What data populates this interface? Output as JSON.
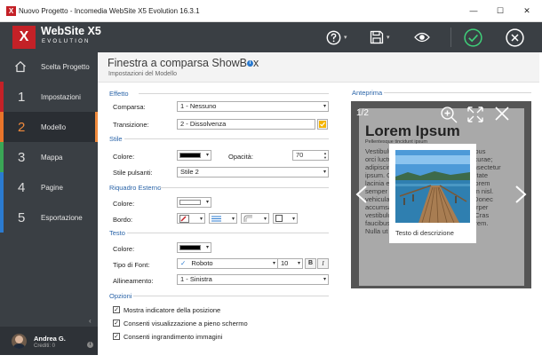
{
  "window": {
    "title": "Nuovo Progetto - Incomedia WebSite X5 Evolution 16.3.1",
    "app_icon_letter": "X",
    "controls": {
      "minimize": "—",
      "maximize": "☐",
      "close": "✕"
    }
  },
  "brand": {
    "logo_mark": "X",
    "name": "WebSite X5",
    "edition": "EVOLUTION"
  },
  "toolbar": {
    "icons": [
      "help-icon",
      "save-icon",
      "preview-eye-icon",
      "confirm-check-icon",
      "close-circle-icon"
    ],
    "chevron": "▾"
  },
  "sidebar": {
    "items": [
      {
        "num": "",
        "label": "Scelta Progetto",
        "icon": "home-icon",
        "color": ""
      },
      {
        "num": "1",
        "label": "Impostazioni",
        "color": "#c42127"
      },
      {
        "num": "2",
        "label": "Modello",
        "color": "#e8742a"
      },
      {
        "num": "3",
        "label": "Mappa",
        "color": "#3aa655"
      },
      {
        "num": "4",
        "label": "Pagine",
        "color": "#2b7bd0"
      },
      {
        "num": "5",
        "label": "Esportazione",
        "color": "#2b7bd0"
      }
    ],
    "active_index": 2,
    "collapse_glyph": "‹",
    "user": {
      "name": "Andrea G.",
      "credits": "Crediti: 0",
      "info": "i"
    }
  },
  "header": {
    "title": "Finestra a comparsa ShowBox",
    "subtitle": "Impostazioni del Modello",
    "info": "i"
  },
  "form": {
    "effetto": {
      "section": "Effetto",
      "comparsa_label": "Comparsa:",
      "comparsa_value": "1 - Nessuno",
      "transizione_label": "Transizione:",
      "transizione_value": "2 - Dissolvenza"
    },
    "stile": {
      "section": "Stile",
      "colore_label": "Colore:",
      "colore_value": "#000000",
      "opacita_label": "Opacità:",
      "opacita_value": "70",
      "pulsanti_label": "Stile pulsanti:",
      "pulsanti_value": "Stile 2"
    },
    "riquadro": {
      "section": "Riquadro Esterno",
      "colore_label": "Colore:",
      "colore_value": "#ffffff",
      "bordo_label": "Bordo:"
    },
    "testo": {
      "section": "Testo",
      "colore_label": "Colore:",
      "colore_value": "#000000",
      "font_label": "Tipo di Font:",
      "font_value": "Roboto",
      "font_check": "✓",
      "size_value": "10",
      "bold": "B",
      "italic": "I",
      "align_label": "Allineamento:",
      "align_value": "1 - Sinistra"
    },
    "opzioni": {
      "section": "Opzioni",
      "checks": [
        {
          "label": "Mostra indicatore della posizione",
          "checked": "✓"
        },
        {
          "label": "Consenti visualizzazione a pieno schermo",
          "checked": "✓"
        },
        {
          "label": "Consenti ingrandimento immagini",
          "checked": "✓"
        }
      ]
    },
    "dropdown_arrow": "▾",
    "spin_up": "▲",
    "spin_down": "▼"
  },
  "preview": {
    "label": "Anteprima",
    "counter": "1/2",
    "lorem_title": "Lorem Ipsum",
    "lorem_sub": "Pellentesque tincidunt ipsum",
    "lorem_lines": [
      "Vestibulum  ante  ipsum  primis  in  faucibus",
      "orci luctus et ultrices posuere cubilia curae;",
      "adipiscing elit. Sed mattis semper consectetur",
      "ipsum.  Quisque  vel  justo  et  velit  vulputate",
      "lacinia  eget  sed  sapien.  Nam  lacinia  lorem",
      "semper nulla vulputate sed elementum nisl.",
      "vehicula  consequat.  Aliquam  ut  arcu  Donec",
      "accumsan  erat  sit  amet  ligula  ullamcorper",
      "vestibulum  quam.  Mauris  id  mi  risus.  Cras",
      "faucibus justo quis, sollicitudin erat lorem.",
      "Nulla ut eleifend odio, ac mattis tortor."
    ],
    "caption": "Testo di descrizione",
    "icons": [
      "zoom-in-icon",
      "fullscreen-icon",
      "close-icon",
      "arrow-left-icon",
      "arrow-right-icon"
    ]
  }
}
